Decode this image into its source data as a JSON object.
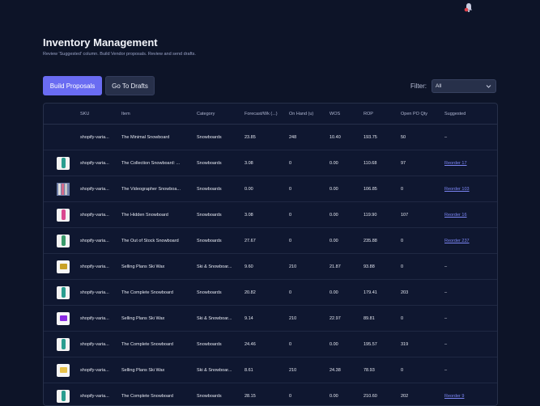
{
  "header": {
    "title": "Inventory Management",
    "subtitle": "Review 'Suggested' column. Build Vendor proposals. Review and send drafts."
  },
  "toolbar": {
    "build_label": "Build Proposals",
    "drafts_label": "Go To Drafts",
    "filter_label": "Filter:",
    "filter_value": "All"
  },
  "table": {
    "columns": [
      "",
      "SKU",
      "Item",
      "Category",
      "Forecast/Wk (...)",
      "On Hand (u)",
      "WOS",
      "ROP",
      "Open PO Qty",
      "Suggested"
    ],
    "rows": [
      {
        "sku": "shopify-varia...",
        "item": "The Minimal Snowboard",
        "category": "Snowboards",
        "forecast": "23.85",
        "onhand": "248",
        "wos": "10.40",
        "rop": "193.75",
        "openpo": "50",
        "suggested": "–",
        "thumb": "none"
      },
      {
        "sku": "shopify-varia...",
        "item": "The Collection Snowboard: ...",
        "category": "Snowboards",
        "forecast": "3.08",
        "onhand": "0",
        "wos": "0.00",
        "rop": "110.68",
        "openpo": "97",
        "suggested": "Reorder 17",
        "thumb": "board-teal"
      },
      {
        "sku": "shopify-varia...",
        "item": "The Videographer Snowboa...",
        "category": "Snowboards",
        "forecast": "0.00",
        "onhand": "0",
        "wos": "0.00",
        "rop": "106.85",
        "openpo": "0",
        "suggested": "Reorder 103",
        "thumb": "multi"
      },
      {
        "sku": "shopify-varia...",
        "item": "The Hidden Snowboard",
        "category": "Snowboards",
        "forecast": "3.08",
        "onhand": "0",
        "wos": "0.00",
        "rop": "119.90",
        "openpo": "107",
        "suggested": "Reorder 16",
        "thumb": "board-pink"
      },
      {
        "sku": "shopify-varia...",
        "item": "The Out of Stock Snowboard",
        "category": "Snowboards",
        "forecast": "27.67",
        "onhand": "0",
        "wos": "0.00",
        "rop": "235.88",
        "openpo": "0",
        "suggested": "Reorder 237",
        "thumb": "board-green"
      },
      {
        "sku": "shopify-varia...",
        "item": "Selling Plans Ski Wax",
        "category": "Ski & Snowboar...",
        "forecast": "9.60",
        "onhand": "210",
        "wos": "21.87",
        "rop": "93.88",
        "openpo": "0",
        "suggested": "–",
        "thumb": "wax-gold"
      },
      {
        "sku": "shopify-varia...",
        "item": "The Complete Snowboard",
        "category": "Snowboards",
        "forecast": "20.82",
        "onhand": "0",
        "wos": "0.00",
        "rop": "179.41",
        "openpo": "203",
        "suggested": "–",
        "thumb": "board-teal"
      },
      {
        "sku": "shopify-varia...",
        "item": "Selling Plans Ski Wax",
        "category": "Ski & Snowboar...",
        "forecast": "9.14",
        "onhand": "210",
        "wos": "22.97",
        "rop": "89.81",
        "openpo": "0",
        "suggested": "–",
        "thumb": "wax-purple"
      },
      {
        "sku": "shopify-varia...",
        "item": "The Complete Snowboard",
        "category": "Snowboards",
        "forecast": "24.46",
        "onhand": "0",
        "wos": "0.00",
        "rop": "195.57",
        "openpo": "319",
        "suggested": "–",
        "thumb": "board-teal"
      },
      {
        "sku": "shopify-varia...",
        "item": "Selling Plans Ski Wax",
        "category": "Ski & Snowboar...",
        "forecast": "8.61",
        "onhand": "210",
        "wos": "24.38",
        "rop": "78.93",
        "openpo": "0",
        "suggested": "–",
        "thumb": "wax-yellow"
      },
      {
        "sku": "shopify-varia...",
        "item": "The Complete Snowboard",
        "category": "Snowboards",
        "forecast": "28.15",
        "onhand": "0",
        "wos": "0.00",
        "rop": "210.60",
        "openpo": "202",
        "suggested": "Reorder 9",
        "thumb": "board-teal"
      }
    ]
  },
  "colors": {
    "background": "#0d1428",
    "accent": "#6a6cf2",
    "link": "#7c86f5"
  },
  "icons": {
    "notification": "bell-icon",
    "dropdown": "chevron-down-icon"
  }
}
